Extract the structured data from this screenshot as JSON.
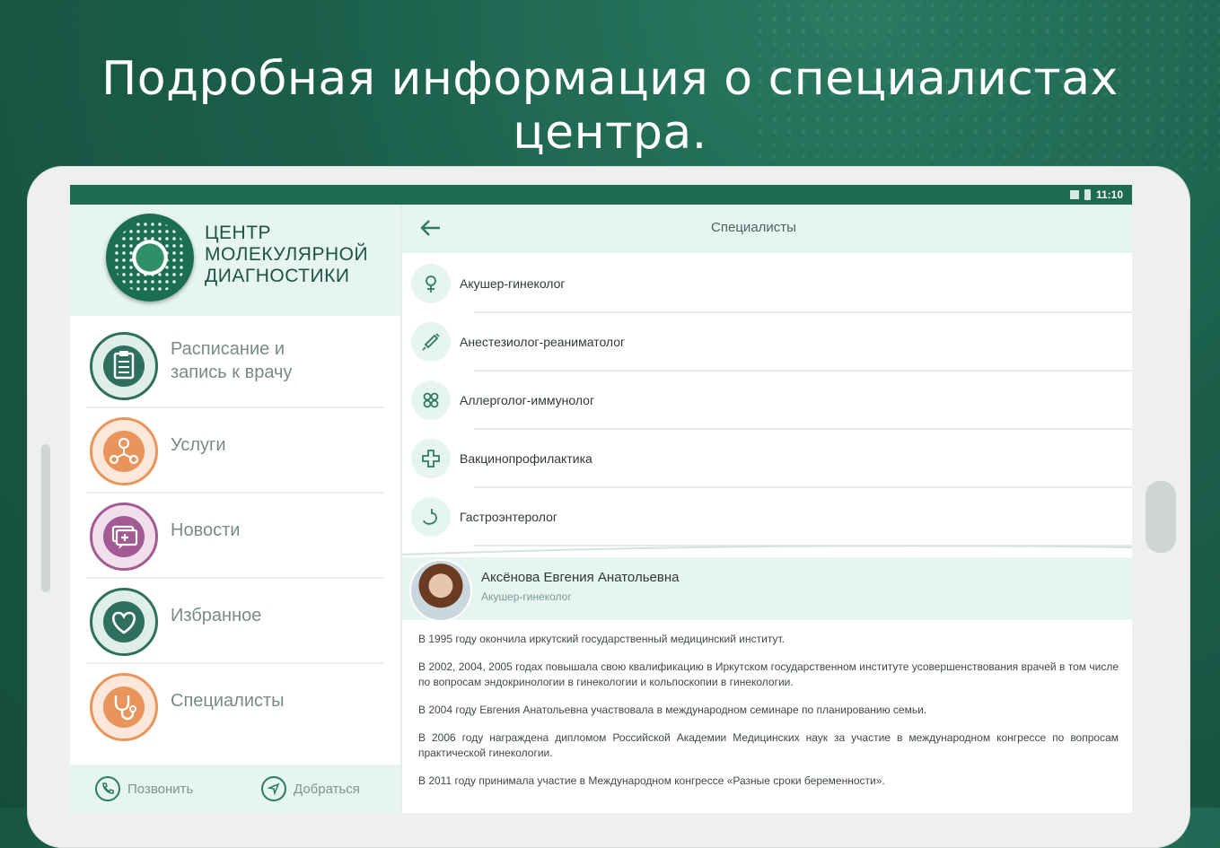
{
  "headline": "Подробная информация о специалистах центра.",
  "status_bar": {
    "time": "11:10"
  },
  "drawer": {
    "logo_lines": [
      "ЦЕНТР",
      "МОЛЕКУЛЯРНОЙ",
      "ДИАГНОСТИКИ"
    ],
    "menu": [
      {
        "label_line1": "Расписание и",
        "label_line2": "запись к врачу",
        "icon": "clipboard-icon",
        "color": "#2e6f5d"
      },
      {
        "label": "Услуги",
        "icon": "molecule-icon",
        "color": "#e9945b"
      },
      {
        "label": "Новости",
        "icon": "news-icon",
        "color": "#a25a93"
      },
      {
        "label": "Избранное",
        "icon": "heart-icon",
        "color": "#2e6f5d"
      },
      {
        "label": "Специалисты",
        "icon": "stethoscope-icon",
        "color": "#e9945b"
      }
    ],
    "footer": {
      "call_label": "Позвонить",
      "route_label": "Добраться"
    }
  },
  "main": {
    "title": "Специалисты",
    "specialties": [
      {
        "label": "Акушер-гинеколог",
        "icon": "female-icon"
      },
      {
        "label": "Анестезиолог-реаниматолог",
        "icon": "syringe-icon"
      },
      {
        "label": "Аллерголог-иммунолог",
        "icon": "allergy-icon"
      },
      {
        "label": "Вакцинопрофилактика",
        "icon": "cross-icon"
      },
      {
        "label": "Гастроэнтеролог",
        "icon": "stomach-icon"
      }
    ],
    "doctor": {
      "name": "Аксёнова Евгения Анатольевна",
      "specialty": "Акушер-гинеколог",
      "bio": [
        "В 1995 году окончила иркутский государственный медицинский институт.",
        "В 2002, 2004, 2005 годах повышала свою квалификацию в Иркутском государственном институте усовершенствования врачей в том числе по вопросам эндокринологии в гинекологии и кольпоскопии в гинекологии.",
        "В 2004 году Евгения Анатольевна участвовала в международном семинаре по планированию семьи.",
        "В 2006 году награждена дипломом Российской Академии Медицинских наук за участие в международном конгрессе по вопросам практической гинекологии.",
        "В 2011 году принимала участие в Международном конгрессе «Разные сроки беременности»."
      ]
    }
  }
}
